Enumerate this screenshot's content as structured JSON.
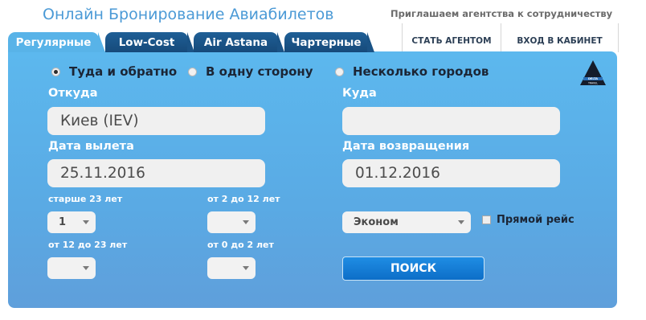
{
  "header": {
    "title": "Онлайн Бронирование Авиабилетов",
    "promo": "Приглашаем агентства к сотрудничеству"
  },
  "top_nav": [
    {
      "label": "СТАТЬ АГЕНТОМ"
    },
    {
      "label": "ВХОД В КАБИНЕТ"
    }
  ],
  "tabs": [
    {
      "label": "Регулярные",
      "active": true
    },
    {
      "label": "Low-Cost",
      "active": false
    },
    {
      "label": "Air Astana",
      "active": false
    },
    {
      "label": "Чартерные",
      "active": false
    }
  ],
  "trip_types": [
    {
      "label": "Туда и обратно",
      "checked": true
    },
    {
      "label": "В одну сторону",
      "checked": false
    },
    {
      "label": "Несколько городов",
      "checked": false
    }
  ],
  "logo": {
    "icon": "delta-travel-logo-icon",
    "text": "DELTA TRAVEL",
    "colors": {
      "triangle": "#141c2b",
      "stripe": "#2a6fb8"
    }
  },
  "form": {
    "from": {
      "label": "Откуда",
      "value": "Киев (IEV)"
    },
    "to": {
      "label": "Куда",
      "value": ""
    },
    "depart": {
      "label": "Дата вылета",
      "value": "25.11.2016"
    },
    "return": {
      "label": "Дата возвращения",
      "value": "01.12.2016"
    }
  },
  "passengers": {
    "adults": {
      "label": "старше 23 лет",
      "value": "1"
    },
    "children": {
      "label": "от 2 до 12 лет",
      "value": ""
    },
    "youth": {
      "label": "от 12 до 23 лет",
      "value": ""
    },
    "infants": {
      "label": "от 0 до 2 лет",
      "value": ""
    }
  },
  "cabin_class": {
    "value": "Эконом"
  },
  "direct_flight": {
    "label": "Прямой рейс",
    "checked": false
  },
  "search_button": {
    "label": "ПОИСК"
  },
  "colors": {
    "panel": "#5ab4ea",
    "tab_dark": "#1a5386",
    "title": "#4b9ad6",
    "button": "#1283dc"
  }
}
